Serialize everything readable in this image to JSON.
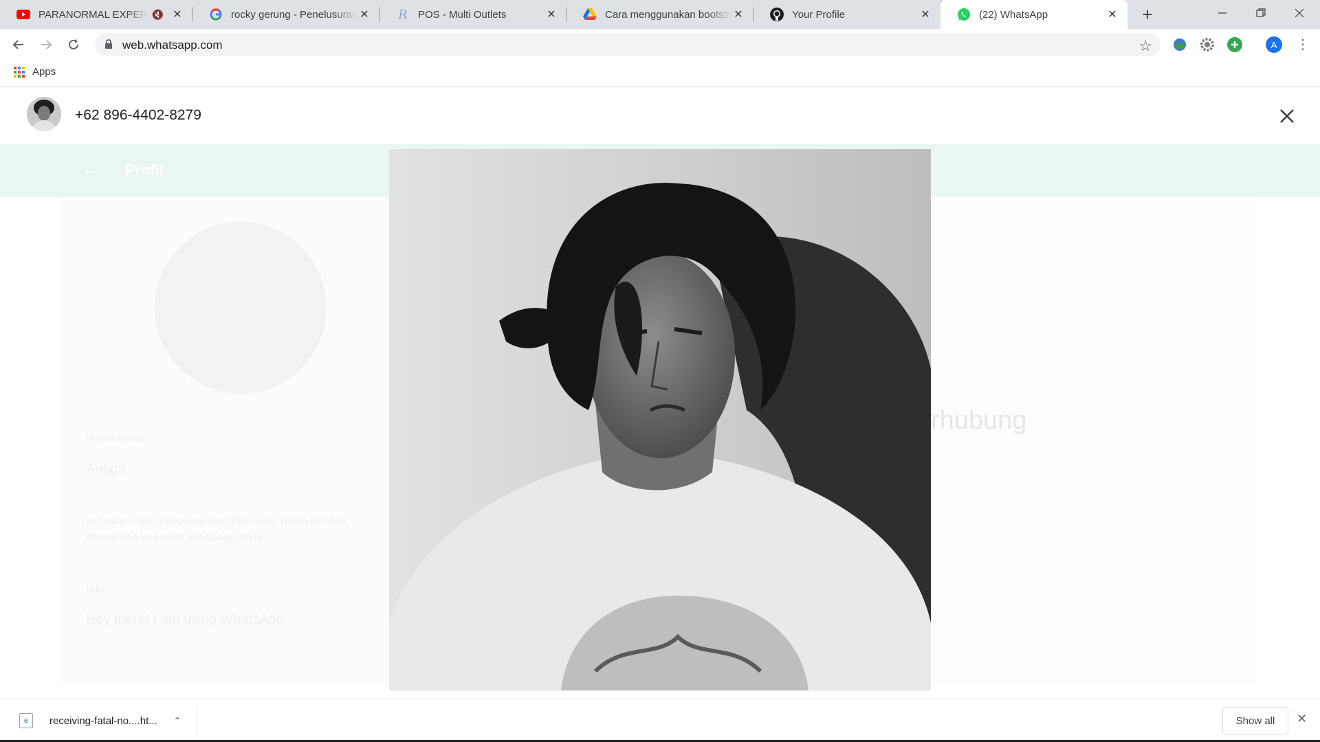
{
  "tabs": [
    {
      "title": "PARANORMAL EXPERIENCE",
      "icon": "youtube-icon",
      "muted": true
    },
    {
      "title": "rocky gerung - Penelusuran Google",
      "icon": "google-icon"
    },
    {
      "title": "POS - Multi Outlets",
      "icon": "pos-icon"
    },
    {
      "title": "Cara menggunakan bootstrap",
      "icon": "google-drive-icon"
    },
    {
      "title": "Your Profile",
      "icon": "github-icon"
    },
    {
      "title": "(22) WhatsApp",
      "icon": "whatsapp-icon",
      "active": true
    }
  ],
  "toolbar": {
    "url": "web.whatsapp.com"
  },
  "bookmarks": {
    "apps_label": "Apps"
  },
  "viewer": {
    "contact_name": "+62 896-4402-8279"
  },
  "background_profile": {
    "header_title": "Profil",
    "name_label": "Nama Anda",
    "name_value": "Angga",
    "name_hint": "Ini bukan nama pengguna atau PIN Anda. Nama ini akan ditampilkan ke kontak WhatsApp Anda.",
    "info_label": "Info",
    "info_value": "Hey there! I am using WhatsApp."
  },
  "background_right": {
    "heading_fragment": "rhubung"
  },
  "download_shelf": {
    "file_name": "receiving-fatal-no....ht...",
    "show_all_label": "Show all"
  },
  "colors": {
    "tab_strip": "#dee1e6",
    "whatsapp_green": "#25d366",
    "profile_header": "#e9f6f4",
    "profile_blue": "#1a73e8"
  }
}
